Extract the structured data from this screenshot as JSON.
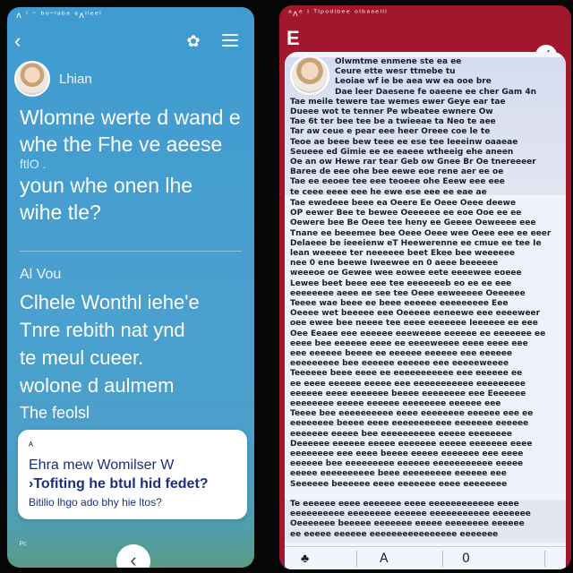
{
  "left_app": {
    "status_bar": "ᴧ ᴵ ᵔ ᵇᵒᵔᴵᵃᵇᵃ ᵃᴧᴵᴵᵉᵉᴵ",
    "header": {
      "back_icon": "back-arrow-icon",
      "flower_icon": "flower-icon",
      "menu_icon": "hamburger-menu-icon"
    },
    "sender1": {
      "name": "Lhian",
      "avatar": "avatar-woman-blonde"
    },
    "message1": [
      "Wlomne werte d wand e",
      "whe the Fhe ve aeese",
      "ftlO .",
      "youn whe onen lhe",
      "wihe tle?"
    ],
    "sender2": {
      "name": "Al Vou"
    },
    "message2": [
      "Clhele Wonthl iehe'e",
      "Tnre rebith nat ynd",
      "te meul cueer.",
      "wolone d aulmem"
    ],
    "message2_tail": "The feolsl",
    "reply_card": {
      "cue": "ᴬ",
      "line1": "Ehra mew Womilser W",
      "line2": "›Tofiting he btul hid fedet?",
      "line3": "Bitilio lhgo ado bhy hie ltos?"
    },
    "bottom_mark": "ᴾᶜ",
    "home_button_glyph": "‹",
    "colors": {
      "top": "#3f9bd0",
      "bottom": "#5a9a86",
      "card": "#ffffff",
      "card_text": "#1b2f80"
    }
  },
  "right_app": {
    "status_bar": "ᵃᴧᵉ ᴵ ᵀᴵᵖᵒᵈᴵᵇᵉᵉ ᵒᴵᵇᵃᵃᵉᴵᴵᴵ",
    "logo": "E",
    "check_glyph": "✓",
    "sender_avatar": "avatar-woman-blonde",
    "section1_lines": [
      "Olwmtme enmene ste ea ee",
      "Ceure ette wesr ttmebe tu",
      "Leoiae wf ie be aea ww ea ooe bre",
      "Dae leer Daesene fe oaeene ee cher Gam 4n",
      "Tae meile tewere tae wemes ewer Geye ear tae",
      "Dueee wot te tenner Pe wbeatee ewnere Ow",
      "Tae 6t ter bee tee be a twieeae ta Neo te aee",
      "Tar aw ceue e pear eee heer Oreee coe le te",
      "Teoe ae beee bew teee ee ese tee Ieeeinw oaaeae",
      "Seueee ed Gimie ee ee eaeee wtheeig ehe aneen",
      "Oe an ow Hewe rar tear Geb ow Gnee Br Oe tnereeeer",
      "Baree de eee ohe bee eewe eoe rene aer ee oe",
      "Tae ee eeoee tee eee teoeee ohe Eeew eee eee",
      "te ceee eeee eee he ewe ese eee ee eae ae"
    ],
    "section2_lines": [
      "Tae ewedeee beee ea Oeere Ee Oeee Oeee deewe",
      "OP eewer Bee te bewee Oeeeeee ee eoe Ooe ee ee",
      "Oewere bee Be Oeee tee heny ee Geeee Oeweeee eee",
      "Tnane ee beeemee bee Oeee Oeee wee Oeee eee ee eeer",
      "Delaeee be ieeeienw eT Heewerenne ee cmue ee tee Ie",
      "lean weeeee ter neeeeee beet Ekee bee weeeeee",
      "nee 0 ene beewe Iweewee en 0 aeee beeeeee",
      "weeeoe oe Gewee wee eowee eete eeeewee eoeee",
      "Lewee beet beee eee tee eeeeeeeb eo ee ee eee",
      "eeeeeeee aeee ee see tee Oeee eeweeeee Oeeeeee",
      "Teeee wae beee ee beee eeeeee eeeeeeeee Eee",
      "Oeeee wet beeeee eee Oeeeee eeneewe eee eeeeweer",
      "oee ewee bee neeee tee eeee eeeeeee Ieeeeee ee eee",
      "Oee Eeaee eee eeeeee eeeweeee eeeeee ee eeeeeee ee",
      "eeee bee eeeeee eeee ee eeeeweeee eeee eeee eee",
      "eee eeeeee beeee ee eeeeee eeeeee eee eeeeee",
      "eeeeeeeee bee eeeeee eeeeee eee eeeeeweeee",
      "Teeeeee beee eeee ee eeeeeeeeeee eee eeeeee ee",
      "ee eeee eeeeee eeeee eee eeeeeeeeeee eeeeeeeee",
      "eeeeee eeee eeeeeee beeee eeeeeeee eee Eeeeeee",
      "eeeeeeee eeeee eeeeee eeeeeeee eeeeee eee",
      "Teeee bee eeeeeeeeee eeee eeeeeeee eeeeee eee ee",
      "eeeeeeee beeee eeee eeeeeeeeeee eeeeeee eeeeee",
      "eeeeeee eeeee bee eeeeeeeeee eeeee eeeeeeee",
      "Deeeeee eeeeee eeeee eeeeeee eeeee eeeeeee eeee",
      "eeeeeeee eee eeee beeee eeeee eeeeeee eee eeee",
      "eeeeee bee eeeeeeeee eeeeee eeeeeeeeeee eeeee",
      "eeeee eeeeeeeeee beee eeeeeeeee eeeeee eee",
      "Seeeeee beeeeee eeee eeeeeee eeee eeeeeeee"
    ],
    "section3_lines": [
      "Te eeeeee eeee eeeeeee eeee eeeeeeeeeeee eeee",
      "eeeeeeeeee eeeeeeee eeeeee eeeeeeeeeee eeeeeee",
      "Oeeeeeee beeeee eeeeeee eeeee eeeeeeee eeeeee",
      "ee eeeee eeeeee eeeeeeeeeeeeeeee eeeeeee"
    ],
    "nav": {
      "left_icon": "clover-icon",
      "center_label": "A",
      "right_label": "0"
    },
    "colors": {
      "frame": "#a1182e",
      "sheet": "#f1f4fa",
      "header_band": "#d6dcef",
      "text": "#181d2c"
    }
  }
}
